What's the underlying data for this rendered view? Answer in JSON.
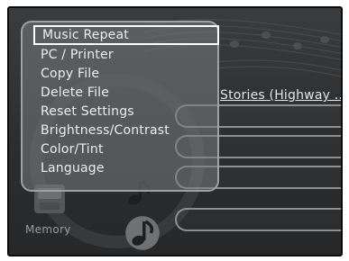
{
  "menu": {
    "selected_index": 0,
    "items": [
      {
        "label": "Music Repeat"
      },
      {
        "label": "PC / Printer"
      },
      {
        "label": "Copy File"
      },
      {
        "label": "Delete File"
      },
      {
        "label": "Reset Settings"
      },
      {
        "label": "Brightness/Contrast"
      },
      {
        "label": "Color/Tint"
      },
      {
        "label": "Language"
      }
    ]
  },
  "player": {
    "track_title": "Stories (Highway ...",
    "memory_label": "Memory"
  },
  "icons": {
    "memory": "memory-card-icon",
    "note": "music-note-icon"
  },
  "colors": {
    "screen_bg": "#2f3133",
    "menu_border": "#9fa2a3",
    "selection_border": "#ffffff",
    "text": "#eeeeee"
  }
}
